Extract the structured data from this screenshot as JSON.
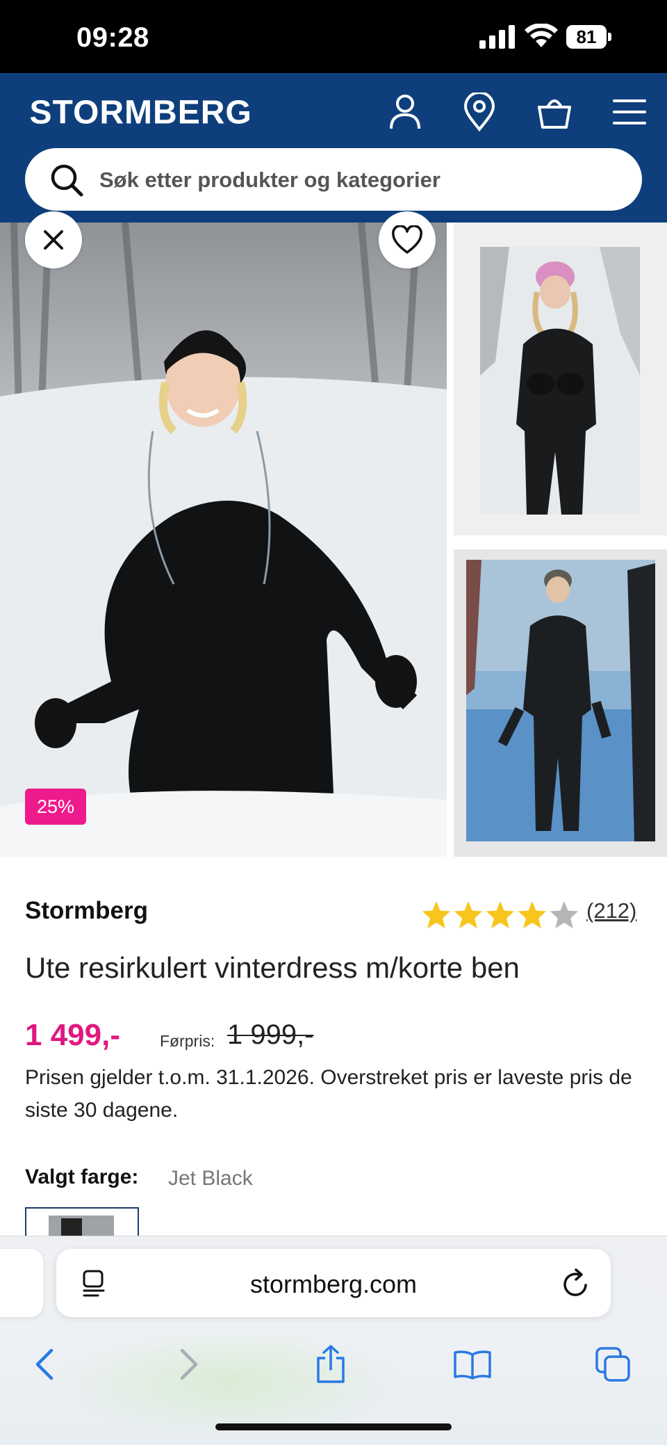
{
  "status_bar": {
    "time": "09:28",
    "battery": "81"
  },
  "header": {
    "brand_logo": "STORMBERG",
    "icons": [
      "user-icon",
      "location-pin-icon",
      "shopping-bag-icon",
      "hamburger-menu-icon"
    ],
    "search_placeholder": "Søk etter produkter og kategorier",
    "bg_color": "#0e3f7c"
  },
  "gallery": {
    "discount_badge": "25%",
    "badge_color": "#ee1b8c",
    "icons": [
      "close-icon",
      "heart-icon"
    ]
  },
  "product": {
    "brand": "Stormberg",
    "rating": 4.5,
    "rating_max": 5,
    "review_count": "(212)",
    "title": "Ute resirkulert vinterdress m/korte ben",
    "price": "1 499,-",
    "previous_price_label": "Førpris:",
    "previous_price": "1 999,-",
    "price_note": "Prisen gjelder t.o.m. 31.1.2026. Overstreket pris er laveste pris de siste 30 dagene.",
    "color_label": "Valgt farge:",
    "color_value": "Jet Black",
    "price_color": "#e0187f"
  },
  "browser": {
    "url": "stormberg.com",
    "toolbar": [
      "back-icon",
      "forward-icon",
      "share-icon",
      "bookmarks-icon",
      "tabs-icon"
    ]
  }
}
